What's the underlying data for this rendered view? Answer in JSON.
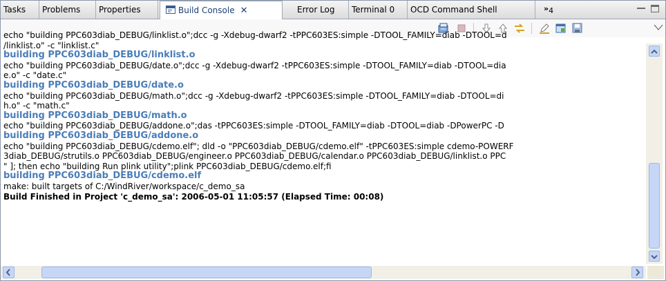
{
  "tabs": [
    {
      "label": "Tasks",
      "active": false
    },
    {
      "label": "Problems",
      "active": false
    },
    {
      "label": "Properties",
      "active": false
    },
    {
      "label": "Build Console",
      "active": true
    },
    {
      "label": "Error Log",
      "active": false
    },
    {
      "label": "Terminal 0",
      "active": false
    },
    {
      "label": "OCD Command Shell",
      "active": false
    }
  ],
  "overflow": {
    "symbol": "»",
    "count": "4"
  },
  "toolbar": {
    "icons": [
      "clear-console-icon",
      "terminate-icon",
      "next-error-icon",
      "previous-error-icon",
      "link-editor-icon",
      "edit-icon",
      "copy-icon",
      "save-icon",
      "view-menu-icon"
    ]
  },
  "console": {
    "lines": [
      {
        "text": "echo \"building PPC603diab_DEBUG/linklist.o\";dcc -g -Xdebug-dwarf2 -tPPC603ES:simple -DTOOL_FAMILY=diab -DTOOL=d",
        "kind": "cmd"
      },
      {
        "text": "/linklist.o\" -c \"linklist.c\"",
        "kind": "cmd"
      },
      {
        "text": "building PPC603diab_DEBUG/linklist.o",
        "kind": "info"
      },
      {
        "text": "echo \"building PPC603diab_DEBUG/date.o\";dcc -g -Xdebug-dwarf2 -tPPC603ES:simple -DTOOL_FAMILY=diab -DTOOL=dia",
        "kind": "cmd"
      },
      {
        "text": "e.o\" -c \"date.c\"",
        "kind": "cmd"
      },
      {
        "text": "building PPC603diab_DEBUG/date.o",
        "kind": "info"
      },
      {
        "text": "echo \"building PPC603diab_DEBUG/math.o\";dcc -g -Xdebug-dwarf2 -tPPC603ES:simple -DTOOL_FAMILY=diab -DTOOL=di",
        "kind": "cmd"
      },
      {
        "text": "h.o\" -c \"math.c\"",
        "kind": "cmd"
      },
      {
        "text": "building PPC603diab_DEBUG/math.o",
        "kind": "info"
      },
      {
        "text": "echo \"building PPC603diab_DEBUG/addone.o\";das -tPPC603ES:simple -DTOOL_FAMILY=diab -DTOOL=diab -DPowerPC -D",
        "kind": "cmd"
      },
      {
        "text": "building PPC603diab_DEBUG/addone.o",
        "kind": "info"
      },
      {
        "text": "echo \"building PPC603diab_DEBUG/cdemo.elf\"; dld -o \"PPC603diab_DEBUG/cdemo.elf\" -tPPC603ES:simple cdemo-POWERF",
        "kind": "cmd"
      },
      {
        "text": "3diab_DEBUG/strutils.o PPC603diab_DEBUG/engineer.o PPC603diab_DEBUG/calendar.o PPC603diab_DEBUG/linklist.o PPC",
        "kind": "cmd"
      },
      {
        "text": "\" ]; then echo \"building Run plink utility\";plink PPC603diab_DEBUG/cdemo.elf;fi",
        "kind": "cmd"
      },
      {
        "text": "building PPC603diab_DEBUG/cdemo.elf",
        "kind": "info"
      },
      {
        "text": "make: built targets of C:/WindRiver/workspace/c_demo_sa",
        "kind": "cmd"
      },
      {
        "text": "Build Finished in Project 'c_demo_sa':   2006-05-01 11:05:57   (Elapsed Time: 00:08)",
        "kind": "finish"
      }
    ]
  },
  "scroll": {
    "vertical_position": 0.72,
    "horizontal_position": 0.0
  },
  "colors": {
    "info_text": "#4a7db8",
    "active_tab_text": "#1c3f74",
    "scroll_thumb": "#c5d6f7"
  }
}
